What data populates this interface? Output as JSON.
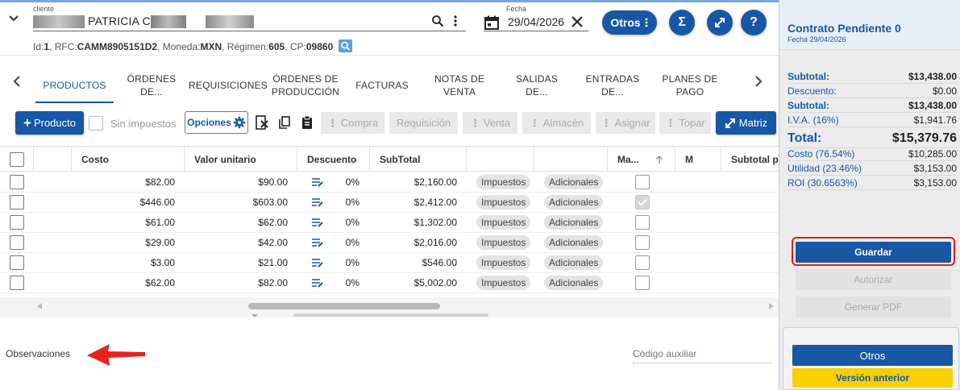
{
  "client": {
    "label": "cliente",
    "name_visible": "PATRICIA C",
    "info": {
      "id_label": "Id:",
      "id": "1",
      "rfc_label": ", RFC:",
      "rfc": "CAMM8905151D2",
      "moneda_label": ", Moneda:",
      "moneda": "MXN",
      "regimen_label": ", Régimen:",
      "regimen": "605",
      "cp_label": ", CP:",
      "cp": "09860"
    }
  },
  "date": {
    "label": "Fecha",
    "value": "29/04/2026"
  },
  "header_buttons": {
    "otros": "Otros",
    "sigma": "Σ",
    "help": "?"
  },
  "tabs": [
    {
      "label": "PRODUCTOS",
      "active": true
    },
    {
      "label": "ÓRDENES DE..."
    },
    {
      "label": "REQUISICIONES"
    },
    {
      "label": "ÓRDENES DE PRODUCCIÓN"
    },
    {
      "label": "FACTURAS"
    },
    {
      "label": "NOTAS DE VENTA"
    },
    {
      "label": "SALIDAS DE..."
    },
    {
      "label": "ENTRADAS DE..."
    },
    {
      "label": "PLANES DE PAGO"
    }
  ],
  "toolbar": {
    "producto": "Producto",
    "sin_impuestos": "Sin impuestos",
    "opciones": "Opciones",
    "compra": "Compra",
    "requisicion": "Requisición",
    "venta": "Venta",
    "almacen": "Almacén",
    "asignar": "Asignar",
    "topar": "Topar",
    "matriz": "Matriz"
  },
  "table": {
    "columns": [
      "Costo",
      "Valor unitario",
      "Descuento",
      "SubTotal",
      "Ma...",
      "M",
      "Subtotal p"
    ],
    "tag_impuestos": "Impuestos",
    "tag_adicionales": "Adicionales",
    "rows": [
      {
        "costo": "$82.00",
        "valor": "$90.00",
        "descuento": "0%",
        "subtotal": "$2,160.00",
        "checked": false
      },
      {
        "costo": "$446.00",
        "valor": "$603.00",
        "descuento": "0%",
        "subtotal": "$2,412.00",
        "checked": true
      },
      {
        "costo": "$61.00",
        "valor": "$62.00",
        "descuento": "0%",
        "subtotal": "$1,302.00",
        "checked": false
      },
      {
        "costo": "$29.00",
        "valor": "$42.00",
        "descuento": "0%",
        "subtotal": "$2,016.00",
        "checked": false
      },
      {
        "costo": "$3.00",
        "valor": "$21.00",
        "descuento": "0%",
        "subtotal": "$546.00",
        "checked": false
      },
      {
        "costo": "$62.00",
        "valor": "$82.00",
        "descuento": "0%",
        "subtotal": "$5,002.00",
        "checked": false
      }
    ]
  },
  "observaciones": "Observaciones",
  "codigo_auxiliar": "Código auxiliar",
  "side": {
    "title": "Contrato Pendiente 0",
    "date": "Fecha 29/04/2026",
    "totals": [
      {
        "k": "Subtotal:",
        "v": "$13,438.00",
        "style": "bold"
      },
      {
        "k": "Descuento:",
        "v": "$0.00",
        "style": ""
      },
      {
        "k": "Subtotal:",
        "v": "$13,438.00",
        "style": "bold"
      },
      {
        "k": "I.V.A. (16%)",
        "v": "$1,941.76",
        "style": ""
      },
      {
        "k": "Total:",
        "v": "$15,379.76",
        "style": "big"
      },
      {
        "k": "Costo (76.54%)",
        "v": "$10,285.00",
        "style": ""
      },
      {
        "k": "Utilidad (23.46%)",
        "v": "$3,153.00",
        "style": ""
      },
      {
        "k": "ROI (30.6563%)",
        "v": "$3,153.00",
        "style": ""
      }
    ],
    "guardar": "Guardar",
    "autorizar": "Autorizar",
    "generar_pdf": "Generar PDF",
    "otros": "Otros",
    "version_anterior": "Versión anterior"
  },
  "colors": {
    "primary": "#1757a6",
    "highlight": "#e21b1b",
    "yellow": "#f7d000"
  }
}
